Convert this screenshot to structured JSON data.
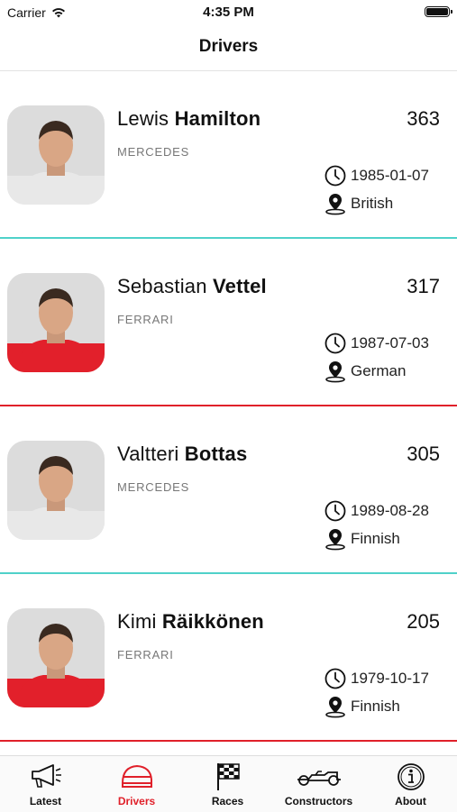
{
  "status_bar": {
    "carrier": "Carrier",
    "time": "4:35 PM"
  },
  "nav": {
    "title": "Drivers"
  },
  "drivers": [
    {
      "first": "Lewis",
      "last": "Hamilton",
      "team": "MERCEDES",
      "points": "363",
      "dob": "1985-01-07",
      "nationality": "British",
      "team_color": "#4fd1c9",
      "suit_color": "#e8e8e8"
    },
    {
      "first": "Sebastian",
      "last": "Vettel",
      "team": "FERRARI",
      "points": "317",
      "dob": "1987-07-03",
      "nationality": "German",
      "team_color": "#e0202a",
      "suit_color": "#e2202b"
    },
    {
      "first": "Valtteri",
      "last": "Bottas",
      "team": "MERCEDES",
      "points": "305",
      "dob": "1989-08-28",
      "nationality": "Finnish",
      "team_color": "#4fd1c9",
      "suit_color": "#e8e8e8"
    },
    {
      "first": "Kimi",
      "last": "Räikkönen",
      "team": "FERRARI",
      "points": "205",
      "dob": "1979-10-17",
      "nationality": "Finnish",
      "team_color": "#e0202a",
      "suit_color": "#e2202b"
    }
  ],
  "tabs": [
    {
      "label": "Latest",
      "icon": "megaphone-icon"
    },
    {
      "label": "Drivers",
      "icon": "helmet-icon"
    },
    {
      "label": "Races",
      "icon": "checkered-flag-icon"
    },
    {
      "label": "Constructors",
      "icon": "race-car-icon"
    },
    {
      "label": "About",
      "icon": "info-icon"
    }
  ],
  "colors": {
    "accent": "#e0202a",
    "mercedes": "#4fd1c9",
    "ferrari": "#e0202a"
  }
}
